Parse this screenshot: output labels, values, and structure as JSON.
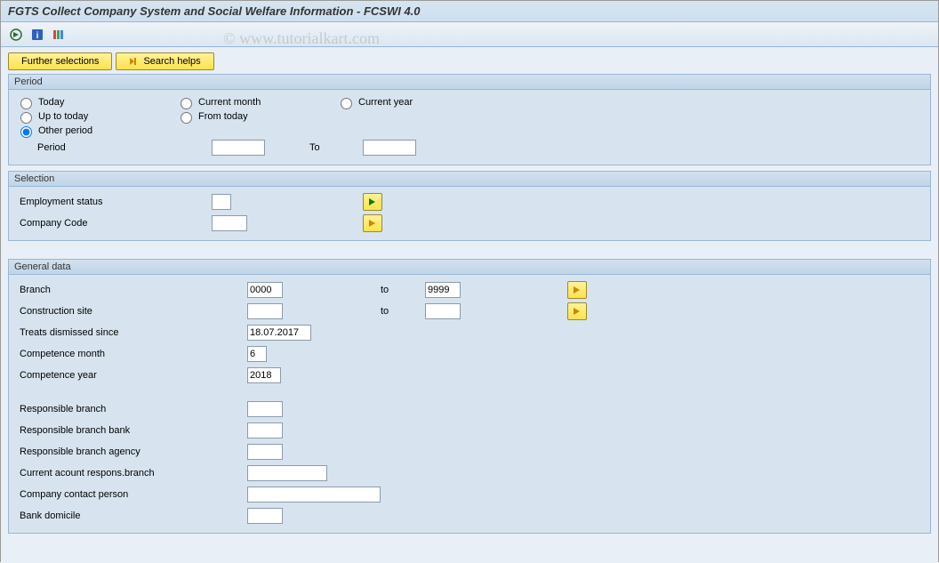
{
  "window": {
    "title": "FGTS Collect Company System and Social Welfare Information - FCSWI 4.0"
  },
  "watermark": "© www.tutorialkart.com",
  "toolbar": {
    "further_selections": "Further selections",
    "search_helps": "Search helps"
  },
  "period": {
    "group_label": "Period",
    "today": "Today",
    "current_month": "Current month",
    "current_year": "Current year",
    "up_to_today": "Up to today",
    "from_today": "From today",
    "other_period": "Other period",
    "period_label": "Period",
    "to_label": "To",
    "period_from": "",
    "period_to": ""
  },
  "selection": {
    "group_label": "Selection",
    "employment_status_label": "Employment status",
    "employment_status": "",
    "company_code_label": "Company Code",
    "company_code": ""
  },
  "general": {
    "group_label": "General data",
    "branch_label": "Branch",
    "branch_from": "0000",
    "to_label": "to",
    "branch_to": "9999",
    "construction_site_label": "Construction site",
    "construction_site_from": "",
    "construction_site_to": "",
    "treats_dismissed_label": "Treats dismissed since",
    "treats_dismissed": "18.07.2017",
    "competence_month_label": "Competence month",
    "competence_month": "6",
    "competence_year_label": "Competence year",
    "competence_year": "2018",
    "responsible_branch_label": "Responsible branch",
    "responsible_branch": "",
    "responsible_branch_bank_label": "Responsible branch bank",
    "responsible_branch_bank": "",
    "responsible_branch_agency_label": "Responsible branch agency",
    "responsible_branch_agency": "",
    "current_account_label": "Current acount respons.branch",
    "current_account": "",
    "company_contact_label": "Company contact person",
    "company_contact": "",
    "bank_domicile_label": "Bank domicile",
    "bank_domicile": ""
  }
}
